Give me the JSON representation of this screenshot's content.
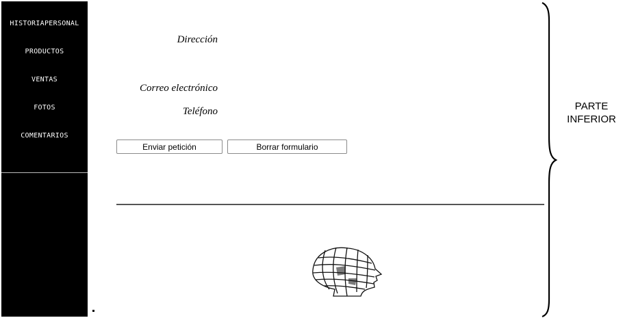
{
  "sidebar": {
    "items": [
      {
        "label": "HISTORIAPERSONAL"
      },
      {
        "label": "PRODUCTOS"
      },
      {
        "label": "VENTAS"
      },
      {
        "label": "FOTOS"
      },
      {
        "label": "COMENTARIOS"
      }
    ]
  },
  "form": {
    "labels": {
      "direccion": "Dirección",
      "correo": "Correo electrónico",
      "telefono": "Teléfono"
    },
    "buttons": {
      "submit": "Enviar petición",
      "reset": "Borrar formulario"
    }
  },
  "annotation": {
    "line1": "PARTE",
    "line2": "INFERIOR"
  }
}
